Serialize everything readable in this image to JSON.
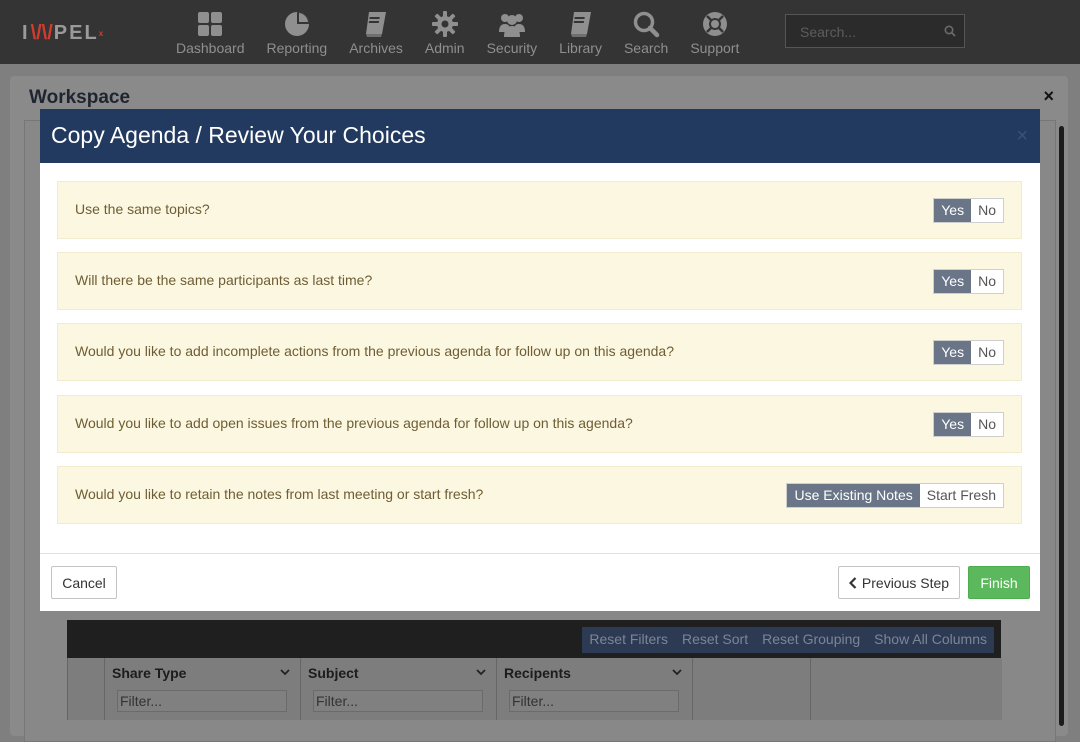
{
  "brand": {
    "logo_text": "I",
    "logo_mark": "\\/\\/",
    "logo_text_end": "PEL",
    "logo_sup": "x"
  },
  "nav": {
    "items": [
      {
        "label": "Dashboard",
        "icon": "grid-icon"
      },
      {
        "label": "Reporting",
        "icon": "pie-chart-icon"
      },
      {
        "label": "Archives",
        "icon": "book-icon"
      },
      {
        "label": "Admin",
        "icon": "gear-icon"
      },
      {
        "label": "Security",
        "icon": "users-icon"
      },
      {
        "label": "Library",
        "icon": "library-book-icon"
      },
      {
        "label": "Search",
        "icon": "search-icon"
      },
      {
        "label": "Support",
        "icon": "lifebuoy-icon"
      }
    ],
    "search_placeholder": "Search..."
  },
  "workspace": {
    "title": "Workspace",
    "close": "×",
    "grid_toolbar": [
      "Reset Filters",
      "Reset Sort",
      "Reset Grouping",
      "Show All Columns"
    ],
    "columns": [
      {
        "title": "Share Type",
        "filter_placeholder": "Filter..."
      },
      {
        "title": "Subject",
        "filter_placeholder": "Filter..."
      },
      {
        "title": "Recipents",
        "filter_placeholder": "Filter..."
      }
    ]
  },
  "modal": {
    "title": "Copy Agenda / Review Your Choices",
    "close": "×",
    "questions": [
      {
        "text": "Use the same topics?",
        "options": [
          "Yes",
          "No"
        ],
        "selected": "Yes"
      },
      {
        "text": "Will there be the same participants as last time?",
        "options": [
          "Yes",
          "No"
        ],
        "selected": "Yes"
      },
      {
        "text": "Would you like to add incomplete actions from the previous agenda for follow up on this agenda?",
        "options": [
          "Yes",
          "No"
        ],
        "selected": "Yes"
      },
      {
        "text": "Would you like to add open issues from the previous agenda for follow up on this agenda?",
        "options": [
          "Yes",
          "No"
        ],
        "selected": "Yes"
      },
      {
        "text": "Would you like to retain the notes from last meeting or start fresh?",
        "options": [
          "Use Existing Notes",
          "Start Fresh"
        ],
        "selected": "Use Existing Notes"
      }
    ],
    "buttons": {
      "cancel": "Cancel",
      "previous": "Previous Step",
      "finish": "Finish"
    }
  },
  "colors": {
    "modal_header": "#223a60",
    "question_bg": "#fcf7e1",
    "toggle_selected": "#6a7588",
    "finish_button": "#5cb85c"
  }
}
